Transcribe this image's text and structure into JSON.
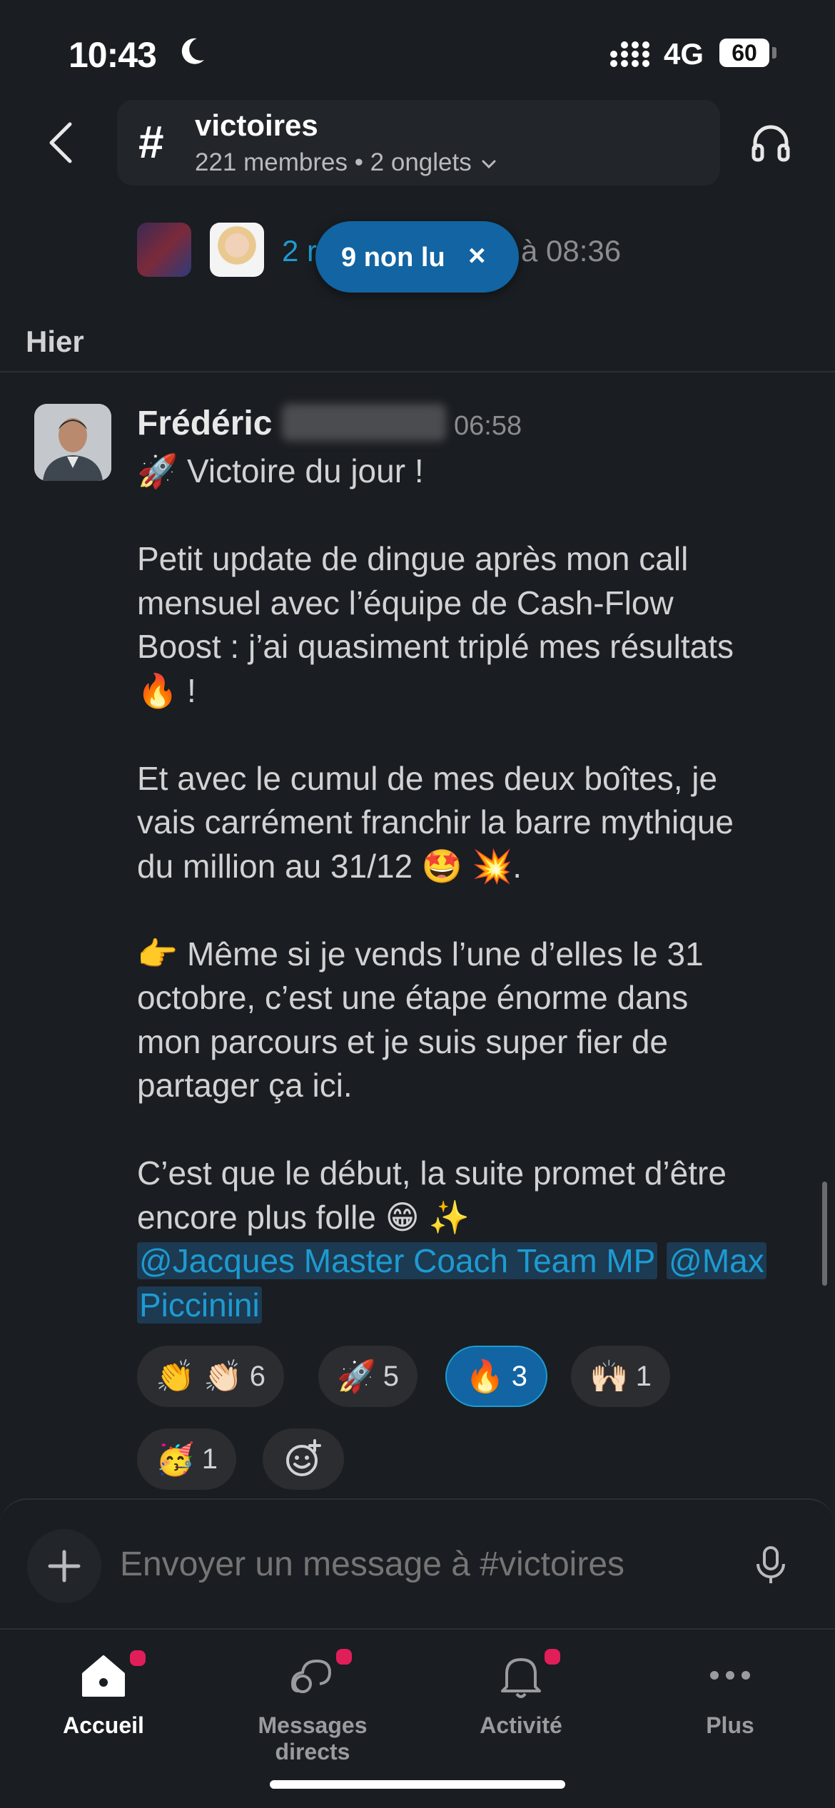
{
  "status_bar": {
    "time": "10:43",
    "network": "4G",
    "battery": "60"
  },
  "header": {
    "channel_hash": "#",
    "channel_name": "victoires",
    "channel_subtitle": "221 membres • 2 onglets"
  },
  "previous_thread": {
    "reply_count_visible": "2 r",
    "reply_time": "à 08:36"
  },
  "unread_pill": {
    "label": "9 non lu",
    "close": "×"
  },
  "day_divider": "Hier",
  "message": {
    "author": "Frédéric",
    "time": "06:58",
    "body": "🚀 Victoire du jour !\n\nPetit update de dingue après mon call\nmensuel avec l’équipe de Cash-Flow\nBoost : j’ai quasiment triplé mes résultats\n🔥 !\n\nEt avec le cumul de mes deux boîtes, je\nvais carrément franchir la barre mythique\ndu million au 31/12 🤩 💥.\n\n👉 Même si je vends l’une d’elles le 31\noctobre, c’est une étape énorme dans\nmon parcours et je suis super fier de\npartager ça ici.\n\nC’est que le début, la suite promet d’être\nencore plus folle 😁 ✨",
    "mention_1": "@Jacques Master Coach Team MP",
    "mention_2a": "@Max",
    "mention_2b": "Piccinini"
  },
  "reactions": [
    {
      "emoji": "👏 👏🏻",
      "count": "6",
      "active": false
    },
    {
      "emoji": "🚀",
      "count": "5",
      "active": false
    },
    {
      "emoji": "🔥",
      "count": "3",
      "active": true
    },
    {
      "emoji": "🙌🏻",
      "count": "1",
      "active": false
    },
    {
      "emoji": "🥳",
      "count": "1",
      "active": false
    }
  ],
  "composer": {
    "placeholder": "Envoyer un message à #victoires",
    "plus": "+"
  },
  "tabs": [
    {
      "label": "Accueil",
      "active": true,
      "badge": true
    },
    {
      "label": "Messages directs",
      "active": false,
      "badge": true
    },
    {
      "label": "Activité",
      "active": false,
      "badge": true
    },
    {
      "label": "Plus",
      "active": false,
      "badge": false
    }
  ],
  "colors": {
    "accent": "#1264a3",
    "link": "#1d9bd1",
    "badge": "#e01e5a",
    "background": "#1a1d21"
  }
}
